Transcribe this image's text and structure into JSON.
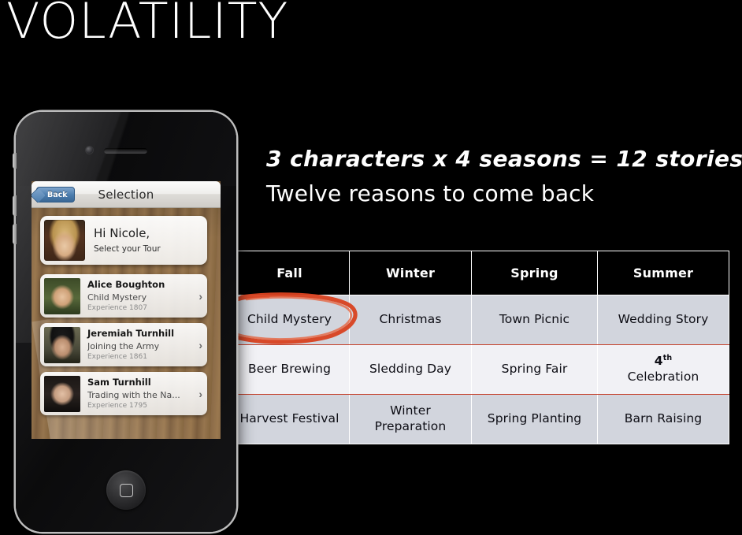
{
  "slide": {
    "title": "VOLATILITY",
    "headline_line1": "3 characters x 4 seasons  = 12 stories",
    "headline_line2": "Twelve reasons to come back",
    "accent_color": "#d8411f",
    "background_color": "#000000"
  },
  "matrix": {
    "columns": [
      "Fall",
      "Winter",
      "Spring",
      "Summer"
    ],
    "rows": [
      {
        "band": "dark",
        "cells": [
          "Child Mystery",
          "Christmas",
          "Town Picnic",
          "Wedding Story"
        ]
      },
      {
        "band": "light",
        "cells": [
          "Beer Brewing",
          "Sledding Day",
          "Spring Fair",
          "4th Celebration"
        ]
      },
      {
        "band": "dark",
        "cells": [
          "Harvest Festival",
          "Winter Preparation",
          "Spring Planting",
          "Barn Raising"
        ]
      }
    ],
    "summer_special": {
      "number": "4",
      "ordinal": "th",
      "word": "Celebration"
    },
    "winter_prep": {
      "line1": "Winter",
      "line2": "Preparation"
    },
    "highlighted_cell": "Child Mystery",
    "header_bg": "#000000",
    "band_dark_bg": "#d2d5dd",
    "band_light_bg": "#f1f1f5"
  },
  "phone": {
    "screen": {
      "navbar": {
        "back_label": "Back",
        "title": "Selection"
      },
      "greeting": {
        "name": "Hi Nicole,",
        "subtitle": "Select your Tour"
      },
      "characters": [
        {
          "name": "Alice Boughton",
          "story": "Child Mystery",
          "experience": "Experience 1807",
          "chevron": "›"
        },
        {
          "name": "Jeremiah Turnhill",
          "story": "Joining the Army",
          "experience": "Experience 1861",
          "chevron": "›"
        },
        {
          "name": "Sam Turnhill",
          "story": "Trading with the Na...",
          "experience": "Experience 1795",
          "chevron": "›"
        }
      ]
    }
  }
}
